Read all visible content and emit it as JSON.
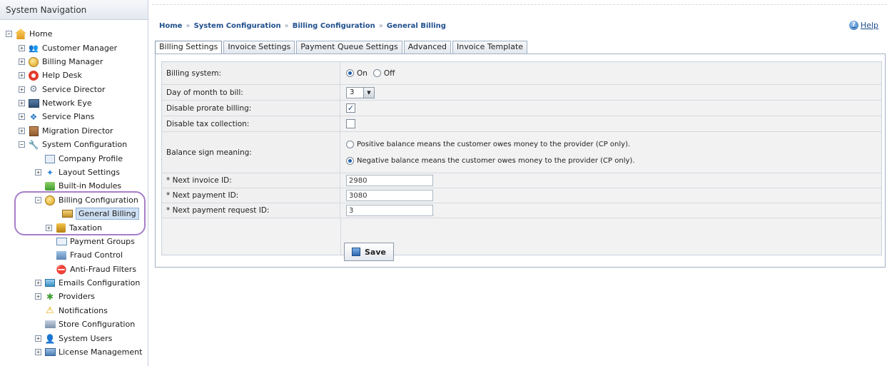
{
  "sidebar": {
    "title": "System Navigation",
    "items": [
      {
        "label": "Home"
      },
      {
        "label": "Customer Manager"
      },
      {
        "label": "Billing Manager"
      },
      {
        "label": "Help Desk"
      },
      {
        "label": "Service Director"
      },
      {
        "label": "Network Eye"
      },
      {
        "label": "Service Plans"
      },
      {
        "label": "Migration Director"
      },
      {
        "label": "System Configuration"
      },
      {
        "label": "Company Profile"
      },
      {
        "label": "Layout Settings"
      },
      {
        "label": "Built-in Modules"
      },
      {
        "label": "Billing Configuration"
      },
      {
        "label": "General Billing"
      },
      {
        "label": "Taxation"
      },
      {
        "label": "Payment Groups"
      },
      {
        "label": "Fraud Control"
      },
      {
        "label": "Anti-Fraud Filters"
      },
      {
        "label": "Emails Configuration"
      },
      {
        "label": "Providers"
      },
      {
        "label": "Notifications"
      },
      {
        "label": "Store Configuration"
      },
      {
        "label": "System Users"
      },
      {
        "label": "License Management"
      }
    ]
  },
  "breadcrumb": [
    "Home",
    "System Configuration",
    "Billing Configuration",
    "General Billing"
  ],
  "help_label": "Help",
  "tabs": [
    "Billing Settings",
    "Invoice Settings",
    "Payment Queue Settings",
    "Advanced",
    "Invoice Template"
  ],
  "form": {
    "billing_system": {
      "label": "Billing system:",
      "on": "On",
      "off": "Off",
      "selected": "On"
    },
    "day_of_month": {
      "label": "Day of month to bill:",
      "value": "3"
    },
    "disable_prorate": {
      "label": "Disable prorate billing:",
      "checked": true,
      "mark": "✓"
    },
    "disable_tax": {
      "label": "Disable tax collection:",
      "checked": false
    },
    "balance_sign": {
      "label": "Balance sign meaning:",
      "positive": "Positive balance means the customer owes money to the provider (CP only).",
      "negative": "Negative balance means the customer owes money to the provider (CP only).",
      "selected": "negative"
    },
    "next_invoice": {
      "label": "* Next invoice ID:",
      "value": "2980"
    },
    "next_payment": {
      "label": "* Next payment ID:",
      "value": "3080"
    },
    "next_payment_request": {
      "label": "* Next payment request ID:",
      "value": "3"
    },
    "save_label": "Save"
  },
  "colors": {
    "link": "#1f4e8c",
    "highlight_ring": "#a77ec9",
    "selected_bg": "#cfe0f4"
  }
}
